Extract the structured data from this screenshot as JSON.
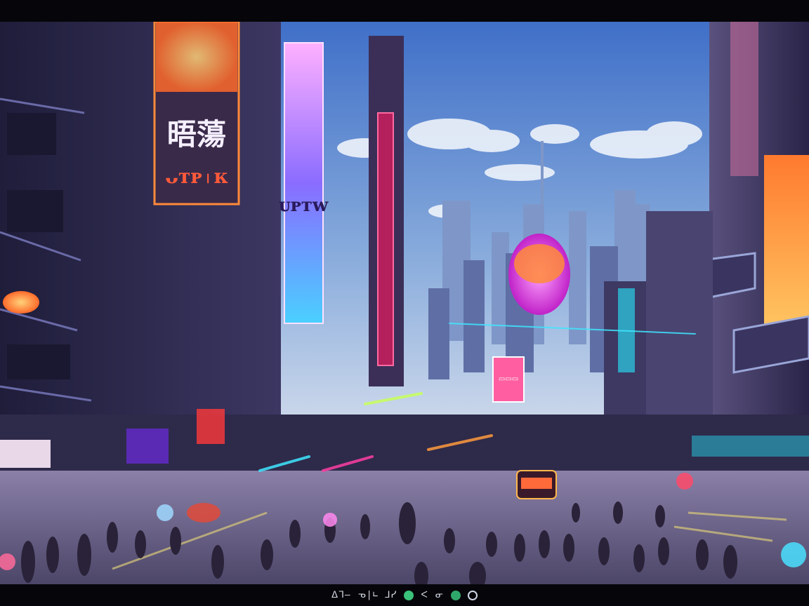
{
  "image": {
    "subject": "Neon-lit futuristic city street crowded with people, flanked by towers covered in glowing signs",
    "signs": {
      "left_big_glyphs": "晤蕩",
      "left_neon_script": "ᴗᴛᴘ꤯ᴋ",
      "tall_banner": "ᴜᴘᴛᴡ",
      "center_board": "▭▭▭"
    },
    "caption": {
      "glyphs_a": "ᐃᒣ—",
      "glyphs_b": "ᓀ|∟ ⅃ᓯ",
      "glyphs_c": "ᐸ",
      "glyphs_d": "ᓂ"
    },
    "colors": {
      "sky_top": "#4f7fd2",
      "sky_bottom": "#b6cdea",
      "street": "#6f6a8e",
      "neon_pink": "#ff3fa4",
      "neon_orange": "#ff9a3c",
      "neon_cyan": "#3fe6ff",
      "neon_purple": "#a64bff",
      "building_dark": "#2a2745",
      "building_mid": "#4a4470"
    }
  }
}
